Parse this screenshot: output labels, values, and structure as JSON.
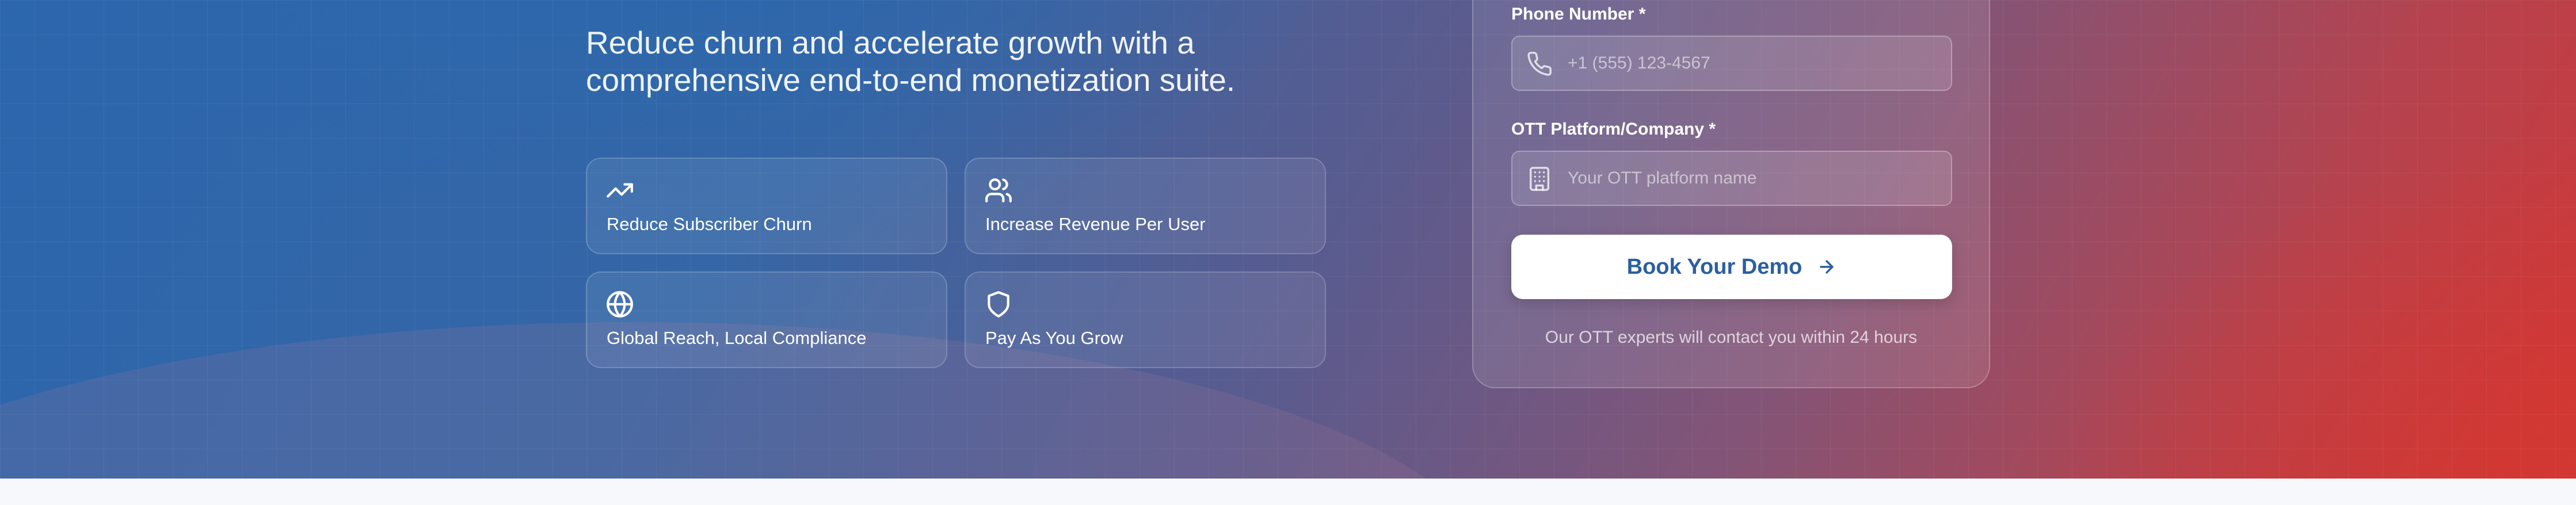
{
  "hero": {
    "tagline": "Reduce churn and accelerate growth with a comprehensive end-to-end monetization suite."
  },
  "features": [
    {
      "label": "Reduce Subscriber Churn",
      "icon": "trending-up-icon"
    },
    {
      "label": "Increase Revenue Per User",
      "icon": "users-icon"
    },
    {
      "label": "Global Reach, Local Compliance",
      "icon": "globe-icon"
    },
    {
      "label": "Pay As You Grow",
      "icon": "shield-icon"
    }
  ],
  "form": {
    "phone_label": "Phone Number *",
    "phone_placeholder": "+1 (555) 123-4567",
    "company_label": "OTT Platform/Company *",
    "company_placeholder": "Your OTT platform name",
    "submit_label": "Book Your Demo",
    "note": "Our OTT experts will contact you within 24 hours"
  },
  "colors": {
    "brand_blue": "#2b5fa0",
    "gradient_start": "#2c66ad",
    "gradient_end": "#cf3838"
  }
}
